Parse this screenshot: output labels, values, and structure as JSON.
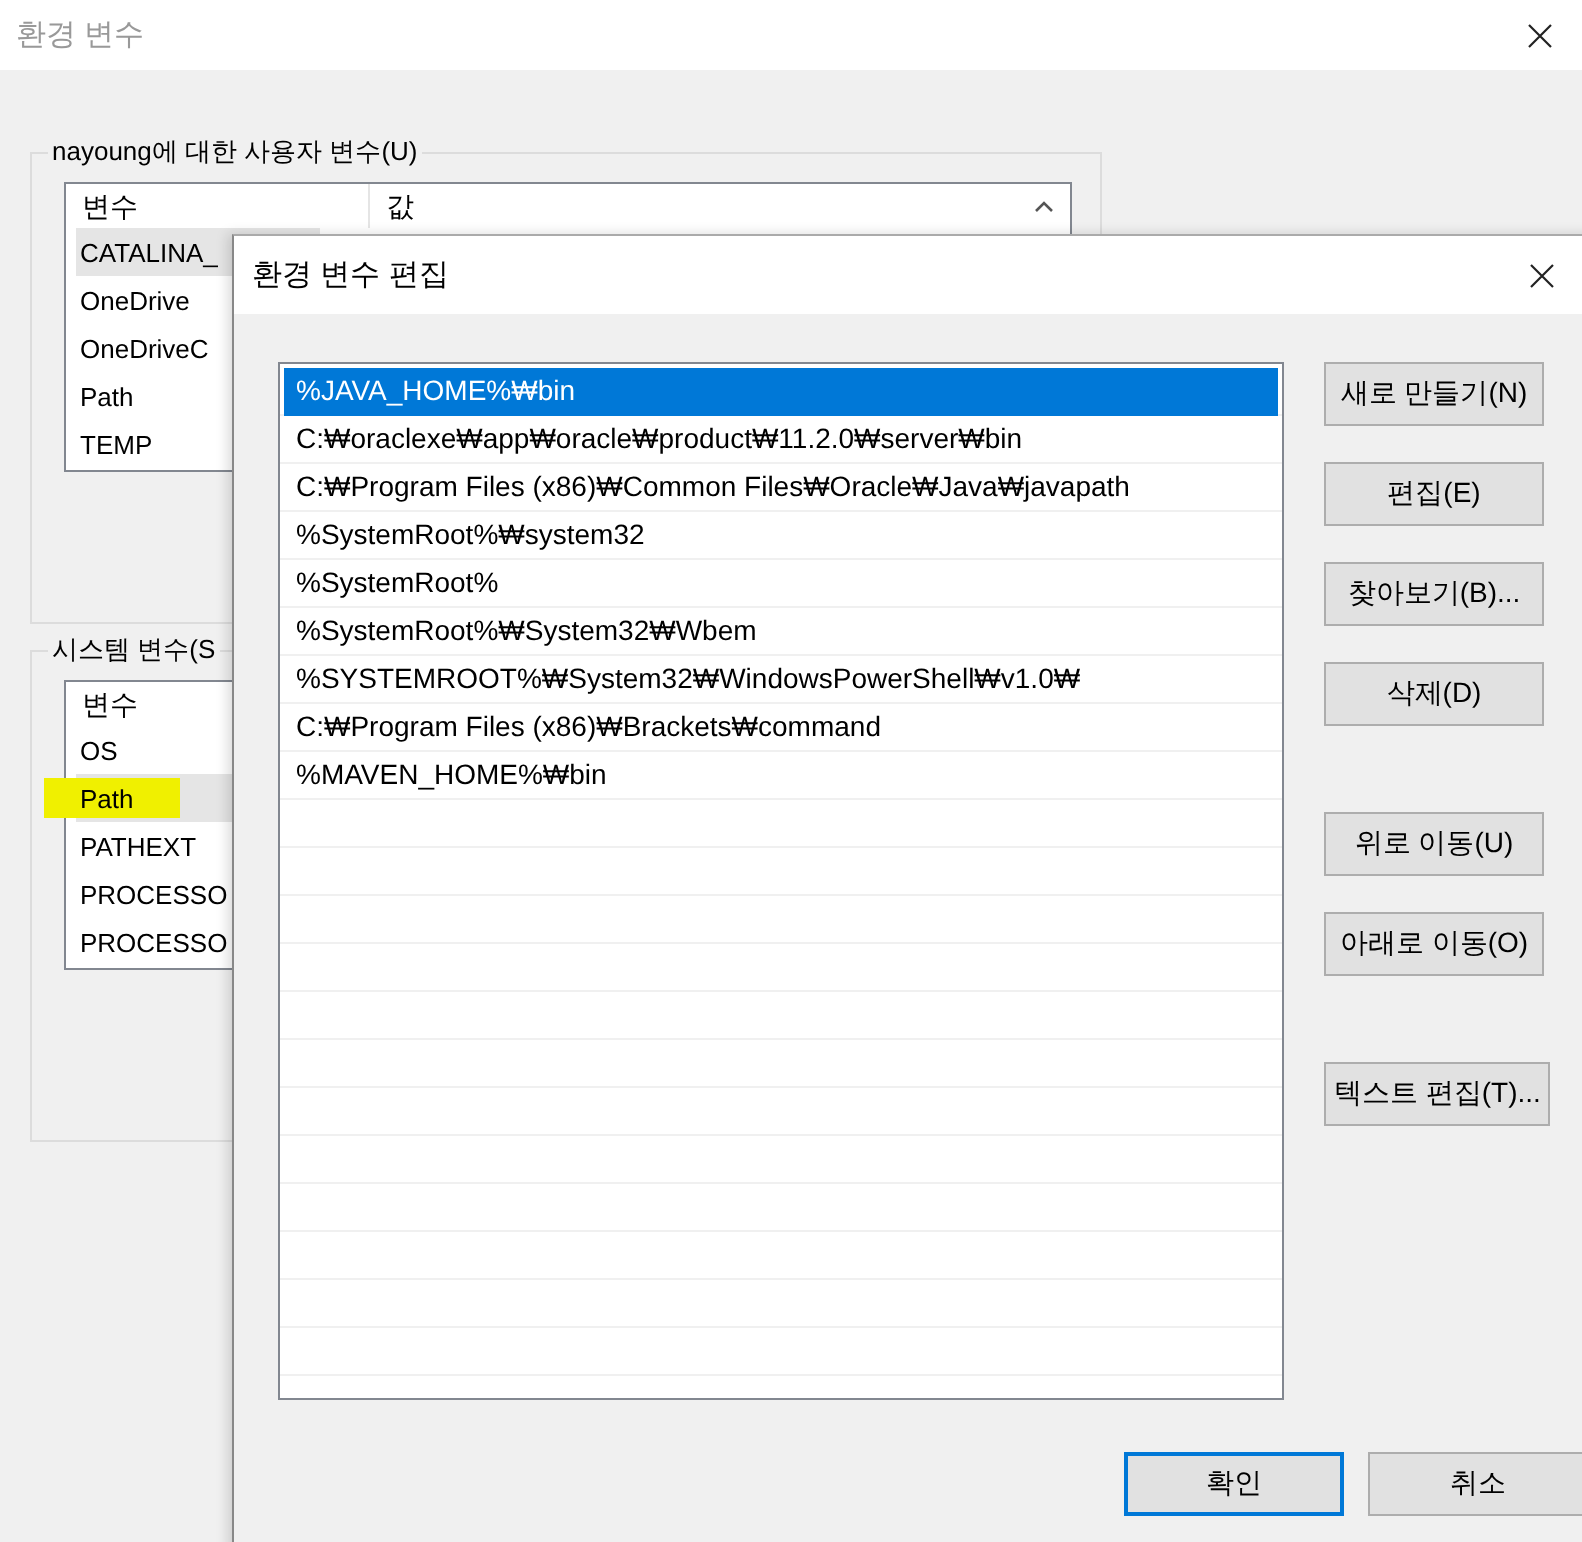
{
  "main_window": {
    "title": "환경 변수",
    "user_variables": {
      "label": "nayoung에 대한 사용자 변수(U)",
      "columns": [
        "변수",
        "값"
      ],
      "rows": [
        {
          "name": "CATALINA_",
          "selected": true
        },
        {
          "name": "OneDrive",
          "selected": false
        },
        {
          "name": "OneDriveC",
          "selected": false
        },
        {
          "name": "Path",
          "selected": false
        },
        {
          "name": "TEMP",
          "selected": false
        }
      ]
    },
    "system_variables": {
      "label": "시스템 변수(S",
      "columns": [
        "변수"
      ],
      "rows": [
        {
          "name": "OS",
          "selected": false
        },
        {
          "name": "Path",
          "selected": true,
          "highlighted": true
        },
        {
          "name": "PATHEXT",
          "selected": false
        },
        {
          "name": "PROCESSO",
          "selected": false
        },
        {
          "name": "PROCESSO",
          "selected": false
        }
      ]
    }
  },
  "edit_dialog": {
    "title": "환경 변수 편집",
    "entries": [
      {
        "text": "%JAVA_HOME%₩bin",
        "selected": true
      },
      {
        "text": "C:₩oraclexe₩app₩oracle₩product₩11.2.0₩server₩bin",
        "selected": false
      },
      {
        "text": "C:₩Program Files (x86)₩Common Files₩Oracle₩Java₩javapath",
        "selected": false
      },
      {
        "text": "%SystemRoot%₩system32",
        "selected": false
      },
      {
        "text": "%SystemRoot%",
        "selected": false
      },
      {
        "text": "%SystemRoot%₩System32₩Wbem",
        "selected": false
      },
      {
        "text": "%SYSTEMROOT%₩System32₩WindowsPowerShell₩v1.0₩",
        "selected": false
      },
      {
        "text": "C:₩Program Files (x86)₩Brackets₩command",
        "selected": false
      },
      {
        "text": "%MAVEN_HOME%₩bin",
        "selected": false
      }
    ],
    "side_button_groups": [
      {
        "buttons": [
          "새로 만들기(N)",
          "편집(E)",
          "찾아보기(B)...",
          "삭제(D)"
        ]
      },
      {
        "buttons": [
          "위로 이동(U)",
          "아래로 이동(O)"
        ]
      },
      {
        "buttons": [
          "텍스트 편집(T)..."
        ]
      }
    ],
    "footer_buttons": [
      {
        "label": "확인",
        "default": true
      },
      {
        "label": "취소",
        "default": false
      }
    ]
  }
}
